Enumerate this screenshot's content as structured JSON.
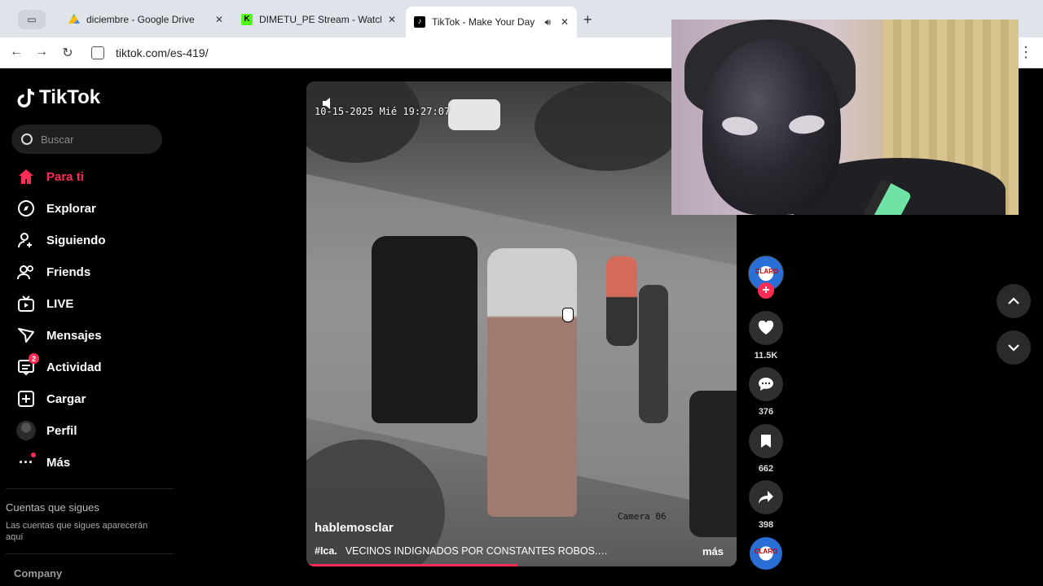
{
  "browser": {
    "tabs": [
      {
        "title": "diciembre - Google Drive",
        "icon": "google-drive-icon",
        "active": false
      },
      {
        "title": "DIMETU_PE Stream - Watch l",
        "icon": "kick-icon",
        "active": false
      },
      {
        "title": "TikTok - Make Your Day",
        "icon": "tiktok-icon",
        "active": true
      }
    ],
    "url": "tiktok.com/es-419/"
  },
  "sidebar": {
    "logo_text": "TikTok",
    "search_placeholder": "Buscar",
    "nav": [
      {
        "label": "Para ti",
        "icon": "home-icon",
        "active": true
      },
      {
        "label": "Explorar",
        "icon": "compass-icon"
      },
      {
        "label": "Siguiendo",
        "icon": "user-follow-icon"
      },
      {
        "label": "Friends",
        "icon": "friends-icon"
      },
      {
        "label": "LIVE",
        "icon": "live-tv-icon"
      },
      {
        "label": "Mensajes",
        "icon": "send-icon"
      },
      {
        "label": "Actividad",
        "icon": "activity-icon",
        "badge": "2"
      },
      {
        "label": "Cargar",
        "icon": "upload-plus-icon"
      },
      {
        "label": "Perfil",
        "icon": "avatar"
      },
      {
        "label": "Más",
        "icon": "more-dots-icon"
      }
    ],
    "following_title": "Cuentas que sigues",
    "following_desc": "Las cuentas que sigues aparecerán aquí",
    "company": "Company"
  },
  "video": {
    "timestamp": "10-15-2025 Mié 19:27:07",
    "camera": "Camera 06",
    "author": "hablemosclar",
    "hashtag": "#Ica.",
    "caption": "VECINOS INDIGNADOS POR CONSTANTES ROBOS.…",
    "more_label": "más",
    "progress": 0.49
  },
  "actions": {
    "creator_badge": "CLARO",
    "likes": "11.5K",
    "comments": "376",
    "saves": "662",
    "shares": "398"
  },
  "colors": {
    "accent": "#fe2c55",
    "background": "#000000"
  }
}
